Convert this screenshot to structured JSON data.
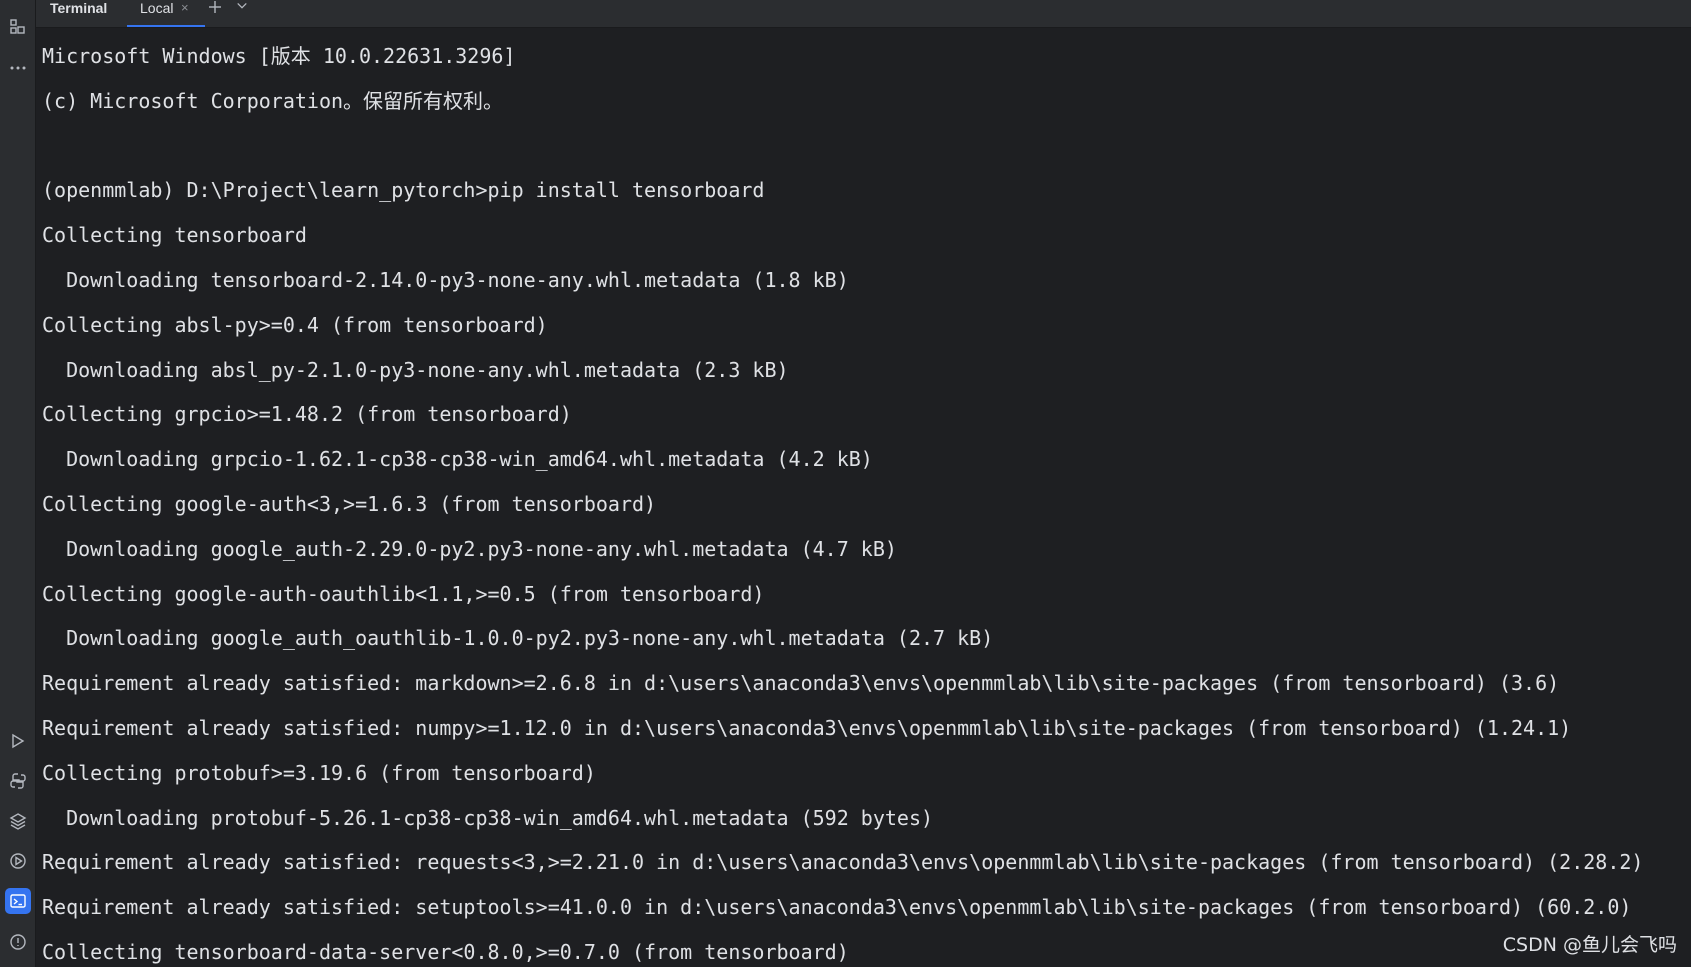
{
  "toolwindow": {
    "title": "Terminal",
    "tab_label": "Local",
    "tab_close": "×"
  },
  "terminal": {
    "lines": [
      "Microsoft Windows [版本 10.0.22631.3296]",
      "(c) Microsoft Corporation。保留所有权利。",
      "",
      "(openmmlab) D:\\Project\\learn_pytorch>pip install tensorboard",
      "Collecting tensorboard",
      "  Downloading tensorboard-2.14.0-py3-none-any.whl.metadata (1.8 kB)",
      "Collecting absl-py>=0.4 (from tensorboard)",
      "  Downloading absl_py-2.1.0-py3-none-any.whl.metadata (2.3 kB)",
      "Collecting grpcio>=1.48.2 (from tensorboard)",
      "  Downloading grpcio-1.62.1-cp38-cp38-win_amd64.whl.metadata (4.2 kB)",
      "Collecting google-auth<3,>=1.6.3 (from tensorboard)",
      "  Downloading google_auth-2.29.0-py2.py3-none-any.whl.metadata (4.7 kB)",
      "Collecting google-auth-oauthlib<1.1,>=0.5 (from tensorboard)",
      "  Downloading google_auth_oauthlib-1.0.0-py2.py3-none-any.whl.metadata (2.7 kB)",
      "Requirement already satisfied: markdown>=2.6.8 in d:\\users\\anaconda3\\envs\\openmmlab\\lib\\site-packages (from tensorboard) (3.6)",
      "Requirement already satisfied: numpy>=1.12.0 in d:\\users\\anaconda3\\envs\\openmmlab\\lib\\site-packages (from tensorboard) (1.24.1)",
      "Collecting protobuf>=3.19.6 (from tensorboard)",
      "  Downloading protobuf-5.26.1-cp38-cp38-win_amd64.whl.metadata (592 bytes)",
      "Requirement already satisfied: requests<3,>=2.21.0 in d:\\users\\anaconda3\\envs\\openmmlab\\lib\\site-packages (from tensorboard) (2.28.2)",
      "Requirement already satisfied: setuptools>=41.0.0 in d:\\users\\anaconda3\\envs\\openmmlab\\lib\\site-packages (from tensorboard) (60.2.0)",
      "Collecting tensorboard-data-server<0.8.0,>=0.7.0 (from tensorboard)"
    ]
  },
  "watermark": "CSDN @鱼儿会飞吗",
  "icons": {
    "sidebar_top": [
      "structure-icon",
      "more-icon"
    ],
    "sidebar_bottom": [
      "run-icon",
      "python-console-icon",
      "layers-icon",
      "services-icon",
      "terminal-icon",
      "problems-icon"
    ],
    "toolbar": [
      "close-icon",
      "plus-icon",
      "chevron-down-icon"
    ]
  },
  "colors": {
    "background": "#1e1f22",
    "panel": "#2b2d30",
    "text": "#dfe1e5",
    "accent": "#3574f0",
    "icon": "#8c8f94"
  }
}
